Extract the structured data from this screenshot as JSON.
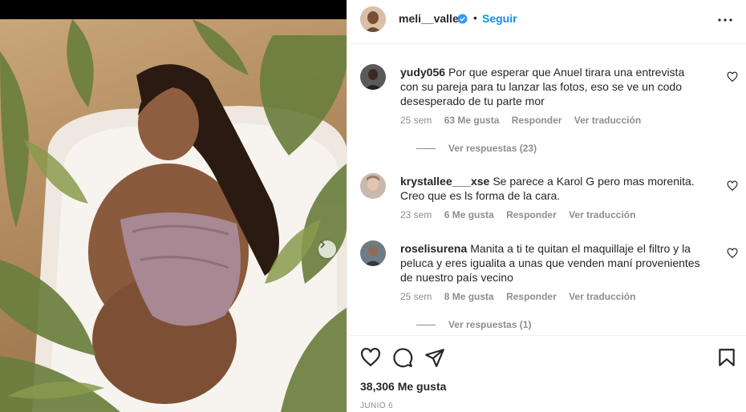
{
  "post": {
    "username": "meli__valle",
    "follow_label": "Seguir",
    "separator": "•",
    "verified_icon": "verified-badge-icon",
    "more_icon": "more-options-icon",
    "likes_text": "38,306 Me gusta",
    "date_text": "JUNIO 6"
  },
  "comments": [
    {
      "username": "yudy056",
      "text": "Por que esperar que Anuel tirara una entrevista con su pareja para tu lanzar las fotos, eso se ve un codo desesperado de tu parte mor",
      "time": "25 sem",
      "likes": "63 Me gusta",
      "reply_label": "Responder",
      "translate_label": "Ver traducción",
      "view_replies": "Ver respuestas (23)"
    },
    {
      "username": "krystallee___xse",
      "text": "Se parece a Karol G pero mas morenita. Creo que es ls forma de la cara.",
      "time": "23 sem",
      "likes": "6 Me gusta",
      "reply_label": "Responder",
      "translate_label": "Ver traducción"
    },
    {
      "username": "roselisurena",
      "text": "Manita a ti te quitan el maquillaje el filtro y la peluca y eres igualita a unas que venden maní provenientes de nuestro país vecino",
      "time": "25 sem",
      "likes": "8 Me gusta",
      "reply_label": "Responder",
      "translate_label": "Ver traducción",
      "view_replies": "Ver respuestas (1)"
    }
  ],
  "icons": {
    "like": "heart-icon",
    "comment": "comment-icon",
    "share": "share-icon",
    "save": "bookmark-icon",
    "next": "chevron-right-icon"
  },
  "colors": {
    "accent": "#0095f6",
    "verified": "#3897f0",
    "muted": "#8e8e8e",
    "text": "#262626"
  }
}
